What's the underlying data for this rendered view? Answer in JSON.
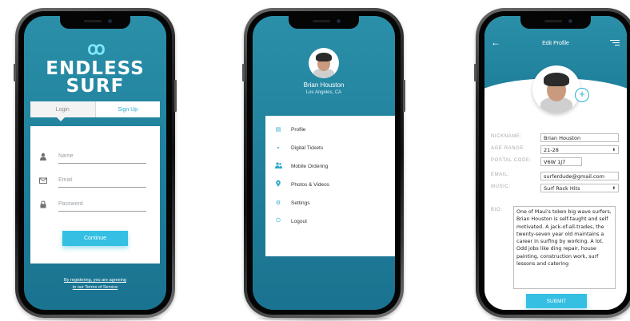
{
  "login_screen": {
    "logo_mark": "ꝏ",
    "logo_line1": "ENDLESS",
    "logo_line2": "SURF",
    "tab_login": "Login",
    "tab_signup": "Sign Up",
    "name_placeholder": "Name",
    "email_placeholder": "Email",
    "password_placeholder": "Password",
    "continue_label": "Continue",
    "terms_line1": "By registering, you are agreeing",
    "terms_line2": "to our Terms of Service"
  },
  "menu_screen": {
    "user_name": "Brian Houston",
    "user_location": "Los Angeles, CA",
    "items": [
      {
        "icon": "profile-icon",
        "glyph": "▤",
        "label": "Profile"
      },
      {
        "icon": "ticket-icon",
        "glyph": "▪",
        "label": "Digital Tickets"
      },
      {
        "icon": "people-icon",
        "glyph": "👥",
        "label": "Mobile Ordering"
      },
      {
        "icon": "pin-icon",
        "glyph": "📍",
        "label": "Photos & Videos"
      },
      {
        "icon": "gear-icon",
        "glyph": "⚙",
        "label": "Settings"
      },
      {
        "icon": "logout-icon",
        "glyph": "⏻",
        "label": "Logout"
      }
    ]
  },
  "edit_screen": {
    "title": "Edit Profile",
    "back_glyph": "←",
    "plus_glyph": "+",
    "nickname_label": "NICKNAME:",
    "nickname_value": "Brian Houston",
    "age_label": "AGE RANGE:",
    "age_value": "21-28",
    "postal_label": "POSTAL CODE:",
    "postal_value": "V6W 1J7",
    "email_label": "EMAIL:",
    "email_value": "surferdude@gmail.com",
    "music_label": "MUSIC:",
    "music_value": "Surf Rock Hits",
    "bio_label": "BIO:",
    "bio_value": "One of Maui's token big wave surfers, Brian Houston is self-taught and self motivated. A jack-of-all-trades, the twenty-seven year old maintains a career in surfing by working. A lot. Odd jobs like ding repair, house painting, construction work, surf lessons and catering",
    "submit_label": "SUBMIT",
    "caret_glyph": "⬍"
  },
  "colors": {
    "teal": "#1f7f9b",
    "accent": "#34bfe3"
  }
}
